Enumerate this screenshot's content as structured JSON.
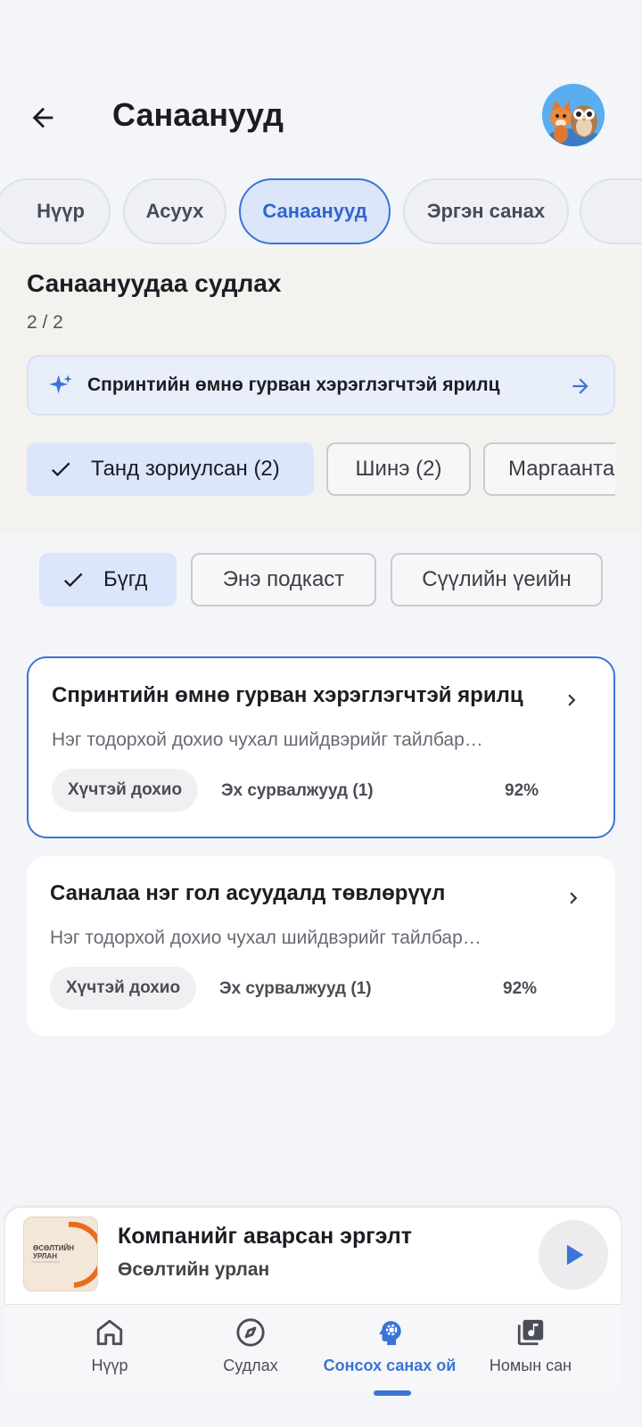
{
  "header": {
    "title": "Санаанууд"
  },
  "tabs": [
    {
      "label": "Нүүр",
      "active": false
    },
    {
      "label": "Асуух",
      "active": false
    },
    {
      "label": "Санаанууд",
      "active": true
    },
    {
      "label": "Эргэн санах",
      "active": false
    }
  ],
  "explore": {
    "title": "Санаануудаа судлах",
    "count": "2 / 2",
    "suggestion": "Спринтийн өмнө гурван хэрэглэгчтэй ярилц",
    "chips": [
      {
        "label": "Танд зориулсан (2)",
        "selected": true
      },
      {
        "label": "Шинэ (2)",
        "selected": false
      },
      {
        "label": "Маргаантай",
        "selected": false
      }
    ]
  },
  "filters": [
    {
      "label": "Бүгд",
      "selected": true
    },
    {
      "label": "Энэ подкаст",
      "selected": false
    },
    {
      "label": "Сүүлийн үеийн",
      "selected": false
    }
  ],
  "cards": [
    {
      "title": "Спринтийн өмнө гурван хэрэглэгчтэй ярилц",
      "description": "Нэг тодорхой дохио чухал шийдвэрийг тайлбар…",
      "badge": "Хүчтэй дохио",
      "sources": "Эх сурвалжууд (1)",
      "percent": "92%"
    },
    {
      "title": "Саналаа нэг гол асуудалд төвлөрүүл",
      "description": "Нэг тодорхой дохио чухал шийдвэрийг тайлбар…",
      "badge": "Хүчтэй дохио",
      "sources": "Эх сурвалжууд (1)",
      "percent": "92%"
    }
  ],
  "player": {
    "title": "Компанийг аварсан эргэлт",
    "subtitle": "Өсөлтийн урлан",
    "cover_text": "ӨСӨЛТИЙН УРЛАН"
  },
  "nav": [
    {
      "label": "Нүүр",
      "icon": "home-icon",
      "active": false
    },
    {
      "label": "Судлах",
      "icon": "compass-icon",
      "active": false
    },
    {
      "label": "Сонсох санах ой",
      "icon": "brain-gear-icon",
      "active": true
    },
    {
      "label": "Номын сан",
      "icon": "library-music-icon",
      "active": false
    }
  ],
  "colors": {
    "accent": "#3b74d6",
    "background": "#f3f5f9",
    "chip_selected": "#dbe6fb"
  }
}
